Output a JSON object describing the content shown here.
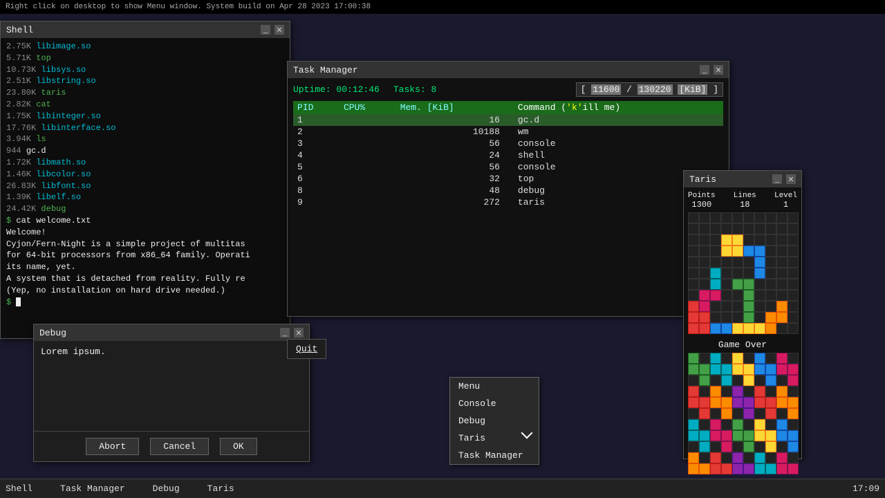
{
  "topbar": {
    "text": "Right click on desktop to show Menu window. System build on Apr 28 2023 17:00:38"
  },
  "shell": {
    "title": "Shell",
    "lines": [
      {
        "size": "2.75K",
        "name": "libimage.so",
        "type": "cyan"
      },
      {
        "size": "5.71K",
        "name": "top",
        "type": "green"
      },
      {
        "size": "10.73K",
        "name": "libsys.so",
        "type": "cyan"
      },
      {
        "size": "2.51K",
        "name": "libstring.so",
        "type": "cyan"
      },
      {
        "size": "23.80K",
        "name": "taris",
        "type": "green"
      },
      {
        "size": "2.82K",
        "name": "cat",
        "type": "green"
      },
      {
        "size": "1.75K",
        "name": "libinteger.so",
        "type": "cyan"
      },
      {
        "size": "17.76K",
        "name": "libinterface.so",
        "type": "cyan"
      },
      {
        "size": "3.94K",
        "name": "ls",
        "type": "green"
      },
      {
        "size": "944",
        "name": "gc.d",
        "type": "normal"
      },
      {
        "size": "1.72K",
        "name": "libmath.so",
        "type": "cyan"
      },
      {
        "size": "1.46K",
        "name": "libcolor.so",
        "type": "cyan"
      },
      {
        "size": "26.83K",
        "name": "libfont.so",
        "type": "cyan"
      },
      {
        "size": "1.39K",
        "name": "libelf.so",
        "type": "cyan"
      },
      {
        "size": "24.42K",
        "name": "debug",
        "type": "green"
      }
    ],
    "cmd1": "$ cat welcome.txt",
    "welcome": "Welcome!",
    "para1": "  Cyjon/Fern-Night is a simple project of multitas",
    "para2": "for 64-bit processors from x86_64 family. Operati",
    "para3": "its name, yet.",
    "para4": "",
    "para5": "  A system that is detached from reality. Fully re",
    "para6": "(Yep, no installation on hard drive needed.)",
    "prompt": "$ "
  },
  "taskmanager": {
    "title": "Task Manager",
    "uptime_label": "Uptime:",
    "uptime_val": "00:12:46",
    "tasks_label": "Tasks:",
    "tasks_val": "8",
    "mem_used": "11600",
    "mem_total": "130220",
    "mem_unit": "[KiB]",
    "table_headers": [
      "PID",
      "CPU%",
      "Mem. [KiB]",
      "Command ('k'ill me)"
    ],
    "processes": [
      {
        "pid": "1",
        "cpu": "",
        "mem": "16",
        "cmd": "gc.d"
      },
      {
        "pid": "2",
        "cpu": "",
        "mem": "10188",
        "cmd": "wm"
      },
      {
        "pid": "3",
        "cpu": "",
        "mem": "56",
        "cmd": "console"
      },
      {
        "pid": "4",
        "cpu": "",
        "mem": "24",
        "cmd": "shell"
      },
      {
        "pid": "5",
        "cpu": "",
        "mem": "56",
        "cmd": "console"
      },
      {
        "pid": "6",
        "cpu": "",
        "mem": "32",
        "cmd": "top"
      },
      {
        "pid": "8",
        "cpu": "",
        "mem": "48",
        "cmd": "debug"
      },
      {
        "pid": "9",
        "cpu": "",
        "mem": "272",
        "cmd": "taris"
      }
    ]
  },
  "debug": {
    "title": "Debug",
    "message": "Lorem ipsum.",
    "abort_label": "Abort",
    "cancel_label": "Cancel",
    "ok_label": "OK"
  },
  "quit": {
    "label": "Quit"
  },
  "context_menu": {
    "items": [
      "Menu",
      "Console",
      "Debug",
      "Taris",
      "Task Manager"
    ]
  },
  "taris": {
    "title": "Taris",
    "points_label": "Points",
    "points_val": "1300",
    "lines_label": "Lines",
    "lines_val": "18",
    "level_label": "Level",
    "level_val": "1",
    "game_over": "Game Over"
  },
  "taskbar": {
    "items": [
      "Shell",
      "Task Manager",
      "Debug",
      "Taris"
    ],
    "time": "17:09"
  }
}
